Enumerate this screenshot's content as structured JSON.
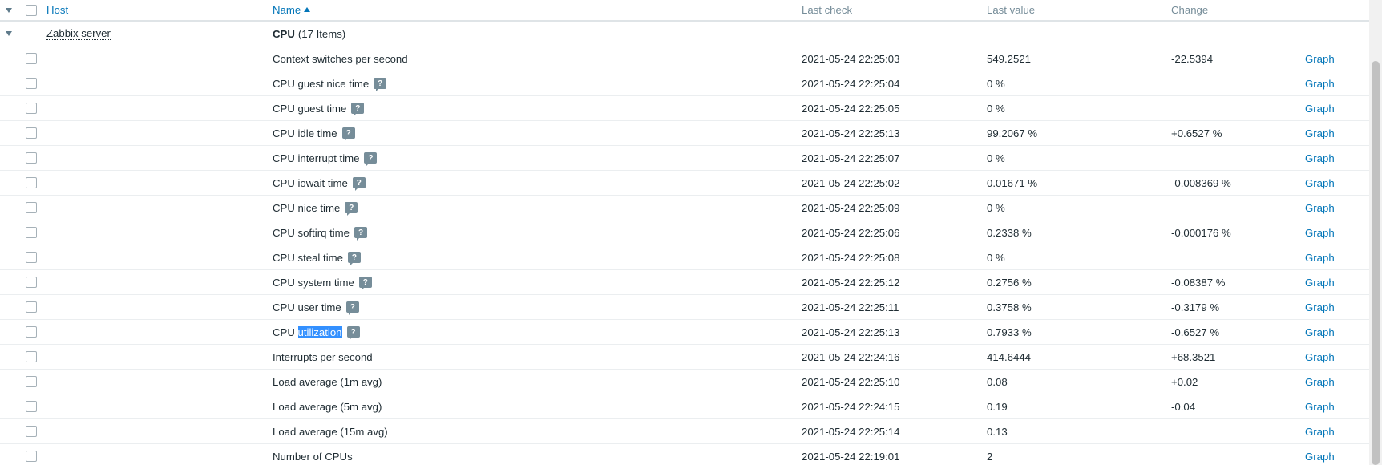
{
  "header": {
    "host": "Host",
    "name": "Name",
    "last_check": "Last check",
    "last_value": "Last value",
    "change": "Change"
  },
  "group": {
    "host": "Zabbix server",
    "name": "CPU",
    "count": "(17 Items)"
  },
  "items": [
    {
      "name": "Context switches per second",
      "hint": false,
      "last_check": "2021-05-24 22:25:03",
      "last_value": "549.2521",
      "change": "-22.5394",
      "graph": "Graph"
    },
    {
      "name": "CPU guest nice time",
      "hint": true,
      "last_check": "2021-05-24 22:25:04",
      "last_value": "0 %",
      "change": "",
      "graph": "Graph"
    },
    {
      "name": "CPU guest time",
      "hint": true,
      "last_check": "2021-05-24 22:25:05",
      "last_value": "0 %",
      "change": "",
      "graph": "Graph"
    },
    {
      "name": "CPU idle time",
      "hint": true,
      "last_check": "2021-05-24 22:25:13",
      "last_value": "99.2067 %",
      "change": "+0.6527 %",
      "graph": "Graph"
    },
    {
      "name": "CPU interrupt time",
      "hint": true,
      "last_check": "2021-05-24 22:25:07",
      "last_value": "0 %",
      "change": "",
      "graph": "Graph"
    },
    {
      "name": "CPU iowait time",
      "hint": true,
      "last_check": "2021-05-24 22:25:02",
      "last_value": "0.01671 %",
      "change": "-0.008369 %",
      "graph": "Graph"
    },
    {
      "name": "CPU nice time",
      "hint": true,
      "last_check": "2021-05-24 22:25:09",
      "last_value": "0 %",
      "change": "",
      "graph": "Graph"
    },
    {
      "name": "CPU softirq time",
      "hint": true,
      "last_check": "2021-05-24 22:25:06",
      "last_value": "0.2338 %",
      "change": "-0.000176 %",
      "graph": "Graph"
    },
    {
      "name": "CPU steal time",
      "hint": true,
      "last_check": "2021-05-24 22:25:08",
      "last_value": "0 %",
      "change": "",
      "graph": "Graph"
    },
    {
      "name": "CPU system time",
      "hint": true,
      "last_check": "2021-05-24 22:25:12",
      "last_value": "0.2756 %",
      "change": "-0.08387 %",
      "graph": "Graph"
    },
    {
      "name": "CPU user time",
      "hint": true,
      "last_check": "2021-05-24 22:25:11",
      "last_value": "0.3758 %",
      "change": "-0.3179 %",
      "graph": "Graph"
    },
    {
      "name": "CPU utilization",
      "name_prefix": "CPU ",
      "name_selected": "utilization",
      "hint": true,
      "last_check": "2021-05-24 22:25:13",
      "last_value": "0.7933 %",
      "change": "-0.6527 %",
      "graph": "Graph"
    },
    {
      "name": "Interrupts per second",
      "hint": false,
      "last_check": "2021-05-24 22:24:16",
      "last_value": "414.6444",
      "change": "+68.3521",
      "graph": "Graph"
    },
    {
      "name": "Load average (1m avg)",
      "hint": false,
      "last_check": "2021-05-24 22:25:10",
      "last_value": "0.08",
      "change": "+0.02",
      "graph": "Graph"
    },
    {
      "name": "Load average (5m avg)",
      "hint": false,
      "last_check": "2021-05-24 22:24:15",
      "last_value": "0.19",
      "change": "-0.04",
      "graph": "Graph"
    },
    {
      "name": "Load average (15m avg)",
      "hint": false,
      "last_check": "2021-05-24 22:25:14",
      "last_value": "0.13",
      "change": "",
      "graph": "Graph"
    },
    {
      "name": "Number of CPUs",
      "hint": false,
      "last_check": "2021-05-24 22:19:01",
      "last_value": "2",
      "change": "",
      "graph": "Graph"
    }
  ],
  "hint_glyph": "?",
  "icons": {
    "collapse": "triangle-down",
    "sort": "arrow-up",
    "hint": "help-speech-bubble"
  },
  "colors": {
    "link": "#0275b8",
    "header_text": "#768d99",
    "text": "#1f2c33",
    "selection": "#3390ff"
  }
}
